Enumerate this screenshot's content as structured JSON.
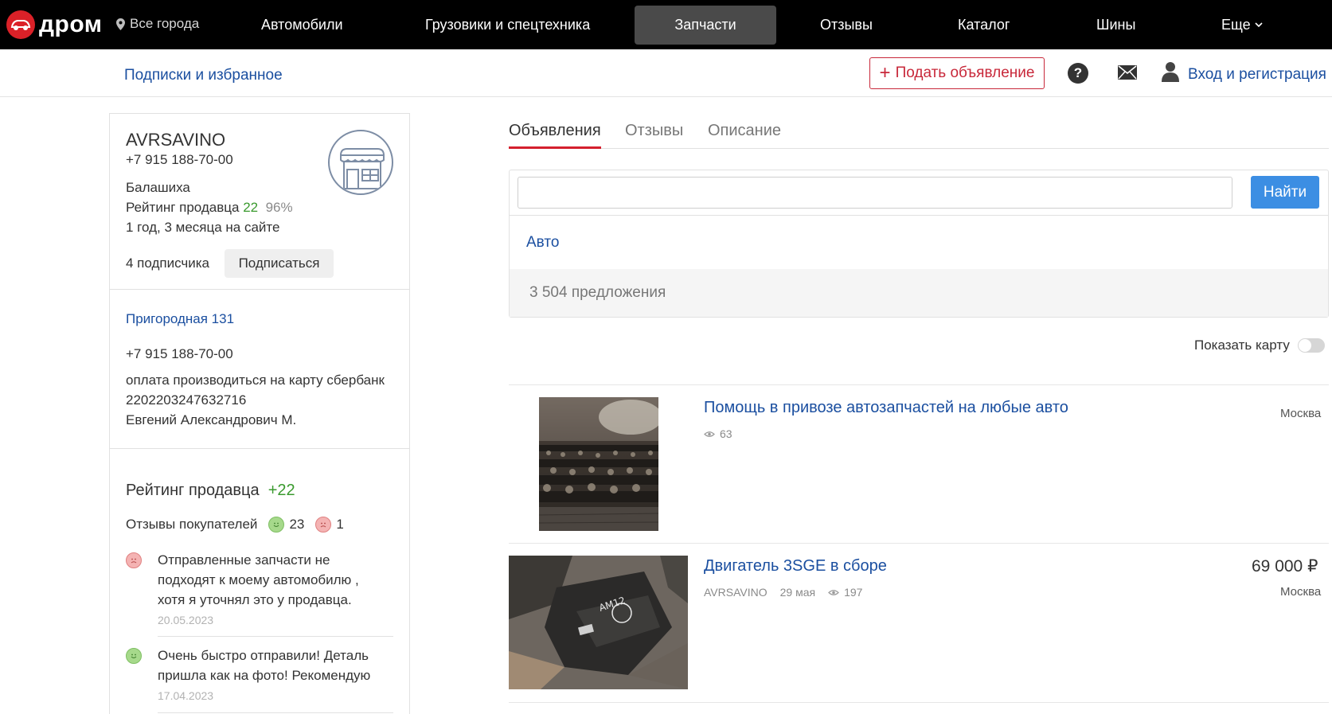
{
  "nav": {
    "logo_text": "дром",
    "city": "Все города",
    "items": [
      "Автомобили",
      "Грузовики и спецтехника",
      "Запчасти",
      "Отзывы",
      "Каталог",
      "Шины",
      "Еще"
    ],
    "active_index": 2
  },
  "subbar": {
    "subscriptions_link": "Подписки и избранное",
    "post_ad_label": "Подать объявление",
    "help_label": "?",
    "login_link": "Вход и регистрация"
  },
  "seller": {
    "name": "AVRSAVINO",
    "phone": "+7 915 188-70-00",
    "city": "Балашиха",
    "rating_label": "Рейтинг продавца",
    "rating_value": "22",
    "rating_percent": "96%",
    "age": "1 год, 3 месяца на сайте",
    "subscribers": "4 подписчика",
    "subscribe_label": "Подписаться",
    "address": "Пригородная 131",
    "phone2": "+7 915 188-70-00",
    "description_lines": [
      "оплата производиться на карту сбербанк",
      "2202203247632716",
      "Евгений Александрович М."
    ]
  },
  "seller_rating": {
    "title": "Рейтинг продавца",
    "value": "+22",
    "reviews_label": "Отзывы покупателей",
    "positive_count": "23",
    "negative_count": "1",
    "reviews": [
      {
        "sentiment": "negative",
        "text": "Отправленные запчасти не подходят к моему автомобилю , хотя я уточнял это у продавца.",
        "date": "20.05.2023"
      },
      {
        "sentiment": "positive",
        "text": "Очень быстро отправили! Деталь пришла как на фото! Рекомендую",
        "date": "17.04.2023"
      }
    ]
  },
  "tabs": [
    "Объявления",
    "Отзывы",
    "Описание"
  ],
  "active_tab": 0,
  "search": {
    "query": "",
    "button_label": "Найти",
    "category_link": "Авто",
    "count_text": "3 504 предложения"
  },
  "map_toggle": {
    "label": "Показать карту",
    "enabled": false
  },
  "listings": [
    {
      "title": "Помощь в привозе автозапчастей на любые авто",
      "seller": "",
      "date": "",
      "views": "63",
      "city": "Москва",
      "price": ""
    },
    {
      "title": "Двигатель 3SGE в сборе",
      "seller": "AVRSAVINO",
      "date": "29 мая",
      "views": "197",
      "city": "Москва",
      "price": "69 000 ₽"
    }
  ],
  "colors": {
    "brand_red": "#db2128",
    "link_blue": "#1b4fa0",
    "button_blue": "#3c8ee3",
    "rating_green": "#3a9a2e"
  }
}
